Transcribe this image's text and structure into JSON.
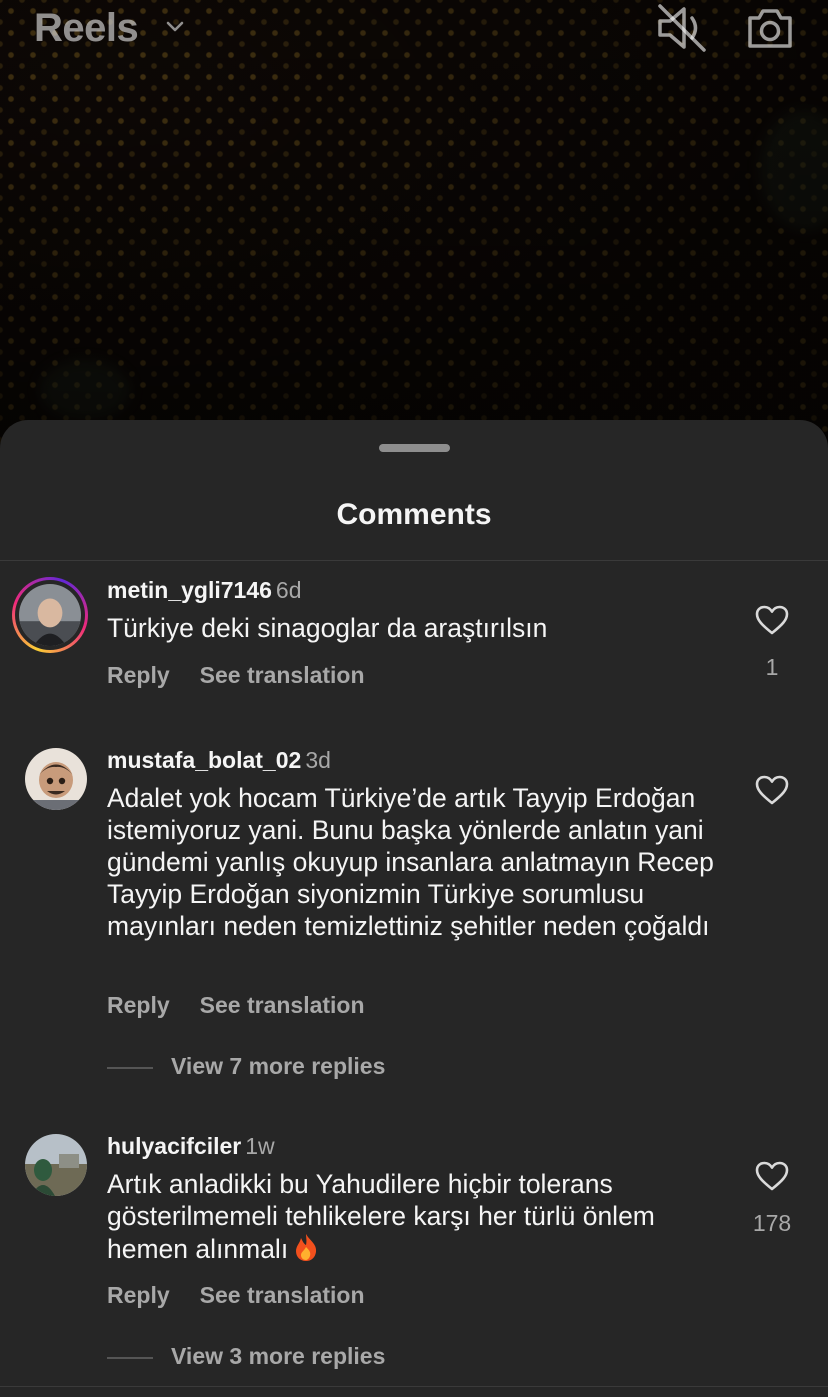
{
  "header": {
    "title": "Reels",
    "icons": [
      "chevron-down-icon",
      "speaker-muted-icon",
      "camera-icon"
    ]
  },
  "sheet": {
    "title": "Comments"
  },
  "comments": [
    {
      "username": "metin_ygli7146",
      "age": "6d",
      "text": "Türkiye deki sinagoglar da araştırılsın",
      "reply_label": "Reply",
      "translate_label": "See translation",
      "likes": "1",
      "has_story_ring": true
    },
    {
      "username": "mustafa_bolat_02",
      "age": "3d",
      "text": "Adalet yok hocam Türkiye’de artık Tayyip Erdoğan istemiyoruz yani. Bunu başka yönlerde anlatın yani gündemi yanlış okuyup insanlara anlatmayın Recep Tayyip Erdoğan siyonizmin Türkiye sorumlusu mayınları neden temizlettiniz şehitler neden çoğaldı",
      "reply_label": "Reply",
      "translate_label": "See translation",
      "likes": "",
      "view_replies": "View 7 more replies"
    },
    {
      "username": "hulyacifciler",
      "age": "1w",
      "text": "Artık anladikki bu Yahudilere hiçbir tolerans gösterilmemeli tehlikelere karşı her türlü önlem hemen alınmalı",
      "emoji": "fire-emoji",
      "reply_label": "Reply",
      "translate_label": "See translation",
      "likes": "178",
      "view_replies": "View 3 more replies"
    }
  ],
  "colors": {
    "sheet_bg": "#262626",
    "primary_text": "#f5f5f5",
    "secondary_text": "#a8a8a8"
  }
}
